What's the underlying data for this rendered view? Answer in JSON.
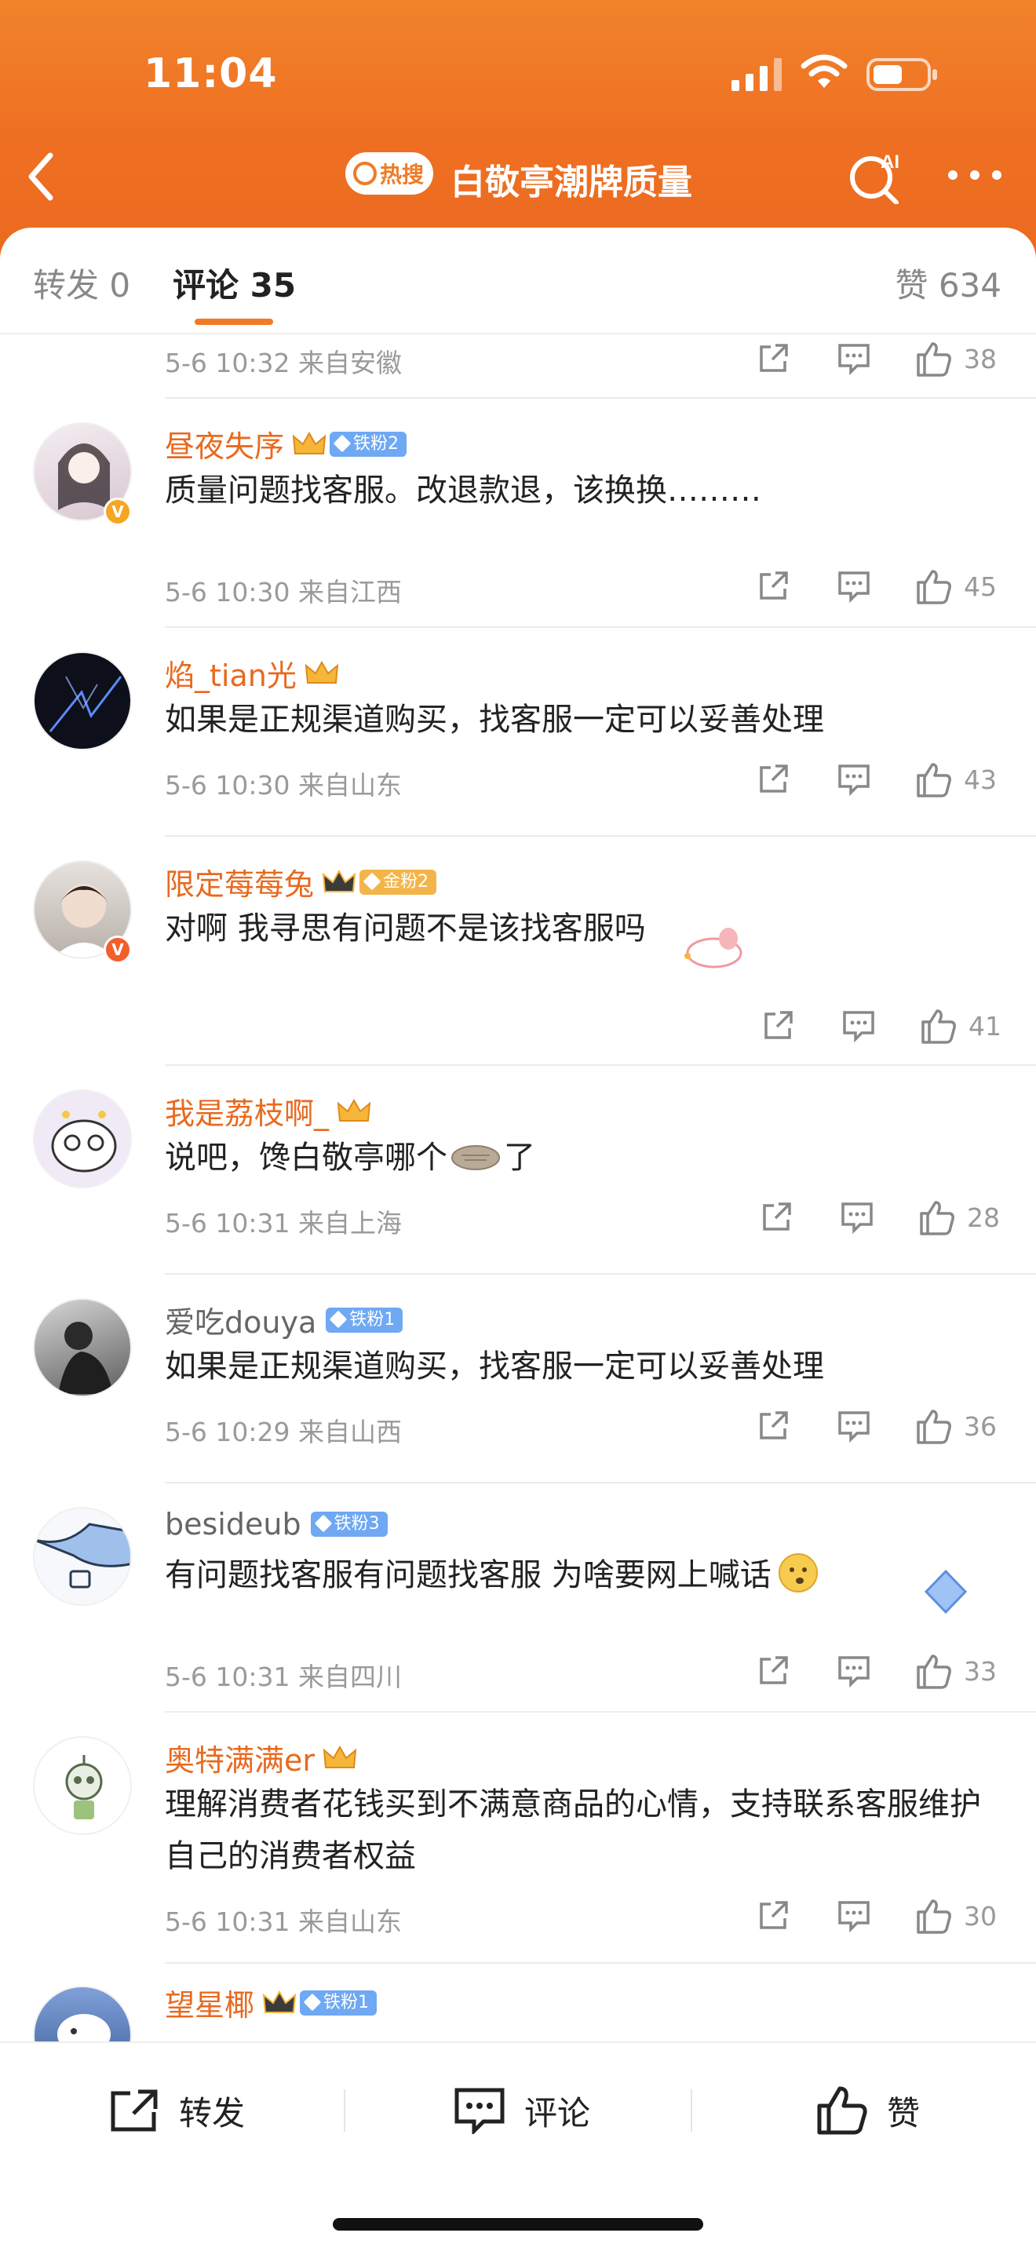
{
  "status": {
    "time": "11:04"
  },
  "header": {
    "hot_label": "热搜",
    "title": "白敬亭潮牌质量"
  },
  "tabs": {
    "repost": "转发 0",
    "comment": "评论 35",
    "like": "赞 634"
  },
  "comments": [
    {
      "user": "",
      "text": "",
      "meta": "5-6 10:32  来自安徽",
      "likes": "38"
    },
    {
      "user": "昼夜失序",
      "fan": "铁粉2",
      "text": "质量问题找客服。改退款退，该换换………",
      "meta": "5-6 10:30  来自江西",
      "likes": "45"
    },
    {
      "user": "焰_tian光",
      "text": "如果是正规渠道购买，找客服一定可以妥善处理",
      "meta": "5-6 10:30  来自山东",
      "likes": "43"
    },
    {
      "user": "限定莓莓兔",
      "fan": "金粉2",
      "text": "对啊 我寻思有问题不是该找客服吗",
      "meta": "",
      "likes": "41"
    },
    {
      "user": "我是荔枝啊_",
      "text": "说吧，馋白敬亭哪个",
      "text_tail": "了",
      "meta": "5-6 10:31  来自上海",
      "likes": "28"
    },
    {
      "user": "爱吃douya",
      "fan": "铁粉1",
      "text": "如果是正规渠道购买，找客服一定可以妥善处理",
      "meta": "5-6 10:29  来自山西",
      "likes": "36"
    },
    {
      "user": "besideub",
      "fan": "铁粉3",
      "text": "有问题找客服有问题找客服 为啥要网上喊话",
      "meta": "5-6 10:31  来自四川",
      "likes": "33"
    },
    {
      "user": "奥特满满er",
      "text": "理解消费者花钱买到不满意商品的心情，支持联系客服维护自己的消费者权益",
      "meta": "5-6 10:31  来自山东",
      "likes": "30"
    },
    {
      "user": "望星椰",
      "fan": "铁粉1"
    }
  ],
  "bottom": {
    "repost": "转发",
    "comment": "评论",
    "like": "赞"
  },
  "colors": {
    "accent": "#f07b26",
    "username": "#e9691e"
  }
}
